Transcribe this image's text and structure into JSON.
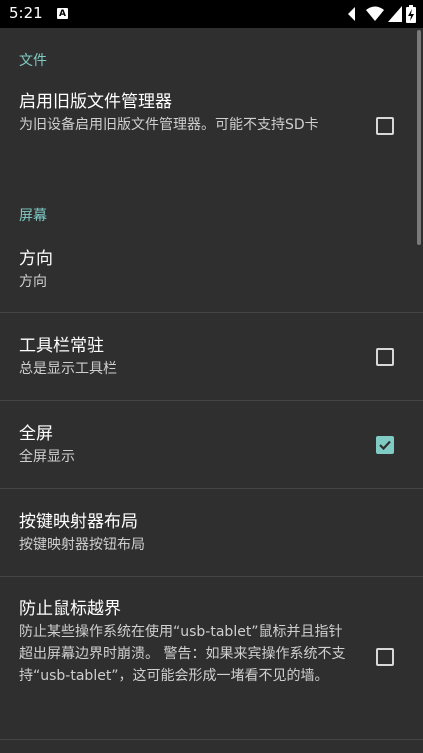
{
  "status_bar": {
    "time": "5:21",
    "notification": "A"
  },
  "sections": {
    "files": "文件",
    "screen": "屏幕"
  },
  "prefs": {
    "legacy_fm": {
      "title": "启用旧版文件管理器",
      "summary": "为旧设备启用旧版文件管理器。可能不支持SD卡",
      "checked": false
    },
    "orientation": {
      "title": "方向",
      "summary": "方向"
    },
    "toolbar": {
      "title": "工具栏常驻",
      "summary": "总是显示工具栏",
      "checked": false
    },
    "fullscreen": {
      "title": "全屏",
      "summary": "全屏显示",
      "checked": true
    },
    "keymapper": {
      "title": "按键映射器布局",
      "summary": "按键映射器按钮布局"
    },
    "mouse": {
      "title": "防止鼠标越界",
      "summary": "防止某些操作系统在使用“usb-tablet”鼠标并且指针超出屏幕边界时崩溃。 警告：如果来宾操作系统不支持“usb-tablet”，这可能会形成一堵看不见的墙。",
      "checked": false
    }
  },
  "colors": {
    "accent": "#80cbc4",
    "background": "#2f2f30"
  }
}
